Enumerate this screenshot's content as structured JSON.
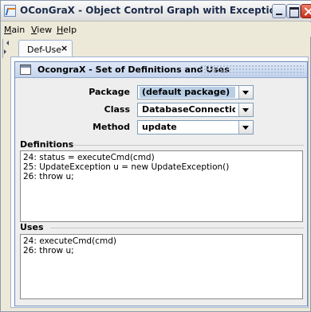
{
  "window": {
    "title": "OConGraX - Object Control Graph with Exceptions"
  },
  "menu": {
    "items": [
      {
        "label": "Main",
        "mnemonic": "M",
        "rest": "ain"
      },
      {
        "label": "View",
        "mnemonic": "V",
        "rest": "iew"
      },
      {
        "label": "Help",
        "mnemonic": "H",
        "rest": "elp"
      }
    ]
  },
  "tab": {
    "label": "Def-Use",
    "close": "×"
  },
  "panel": {
    "title": "OcongraX - Set of Definitions and Uses",
    "package_label": "Package",
    "package_value": "(default package)",
    "class_label": "Class",
    "class_value": "DatabaseConnection",
    "method_label": "Method",
    "method_value": "update"
  },
  "definitions": {
    "title": "Definitions",
    "lines": [
      "24: status = executeCmd(cmd)",
      "25: UpdateException u = new UpdateException()",
      "26: throw u;"
    ]
  },
  "uses": {
    "title": "Uses",
    "lines": [
      "24: executeCmd(cmd)",
      "26: throw u;"
    ]
  },
  "icons": {
    "app": "java-app-icon",
    "minimize": "minimize-icon",
    "maximize": "maximize-icon",
    "close": "close-icon",
    "panel": "window-icon"
  },
  "colors": {
    "selection": "#b8cfe5",
    "header": "#c4d4ee",
    "close_button": "#c7301a"
  }
}
